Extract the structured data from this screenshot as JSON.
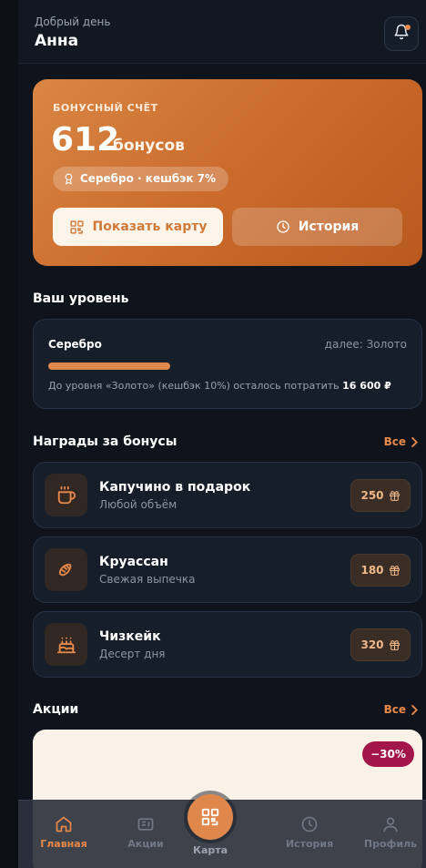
{
  "header": {
    "greeting": "Добрый день",
    "user_name": "Анна",
    "bell_icon": "bell-icon"
  },
  "bonus": {
    "label": "БОНУСНЫЙ СЧЁТ",
    "amount": "612",
    "unit": "бонусов",
    "tier": "Серебро · кешбэк 7%",
    "show_card_label": "Показать карту",
    "history_label": "История"
  },
  "level": {
    "section_title": "Ваш уровень",
    "current": "Серебро",
    "next": "далее: Золото",
    "progress": 0.36,
    "note": "До уровня «Золото» (кешбэк 10%) осталось потратить",
    "remaining": "16 600 ₽"
  },
  "rewards": {
    "section_title": "Награды за бонусы",
    "see_all": "Все",
    "items": [
      {
        "title": "Капучино в подарок",
        "subtitle": "Любой объём",
        "cost": "250",
        "icon": "coffee-cup-icon"
      },
      {
        "title": "Круассан",
        "subtitle": "Свежая выпечка",
        "cost": "180",
        "icon": "croissant-icon"
      },
      {
        "title": "Чизкейк",
        "subtitle": "Десерт дня",
        "cost": "320",
        "icon": "cake-icon"
      }
    ]
  },
  "promos": {
    "section_title": "Акции",
    "see_all": "Все",
    "badge": "−30%"
  },
  "tabbar": {
    "home": "Главная",
    "promos": "Акции",
    "card": "Карта",
    "history": "История",
    "profile": "Профиль"
  },
  "colors": {
    "accent": "#e8894a",
    "background": "#0f141c",
    "promo_badge": "#a3164a"
  }
}
